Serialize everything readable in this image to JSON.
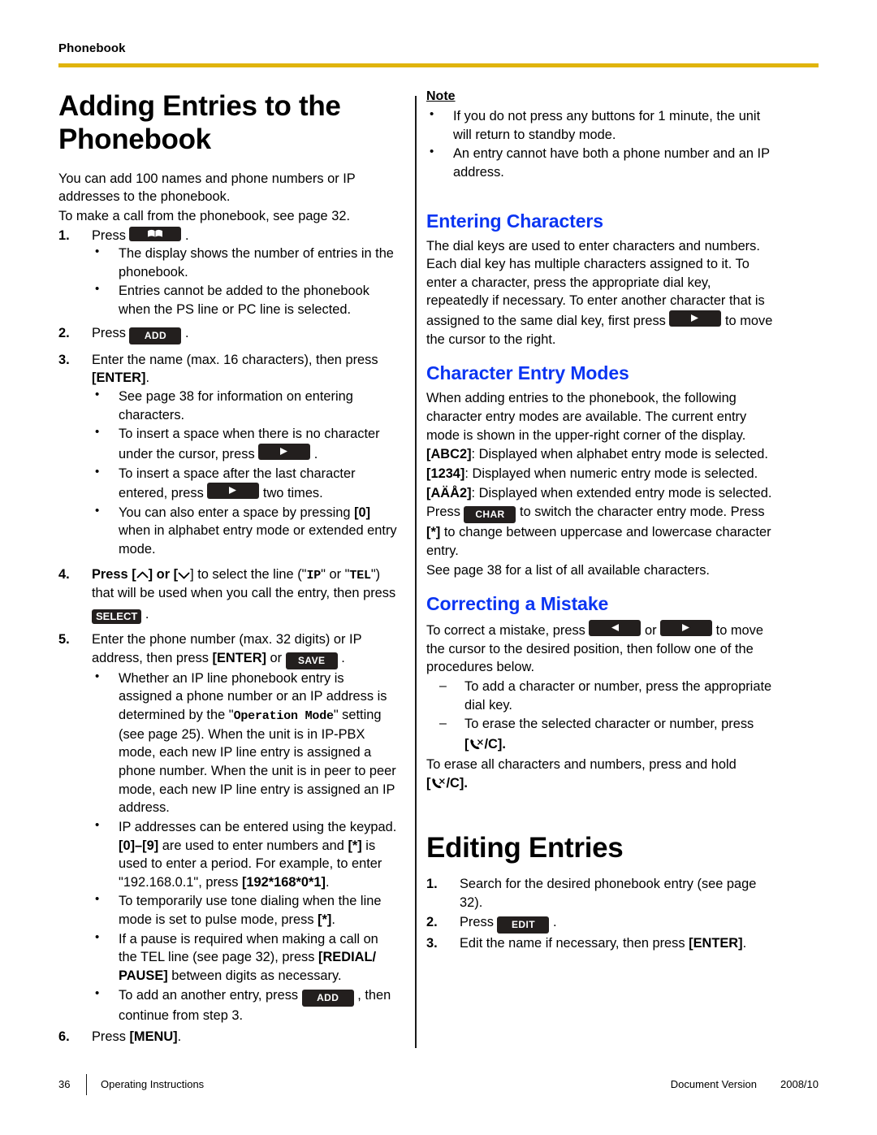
{
  "header": {
    "running_head": "Phonebook",
    "rule_color": "#E0B40C"
  },
  "colors": {
    "heading_blue": "#0B35F2",
    "chip_dark": "#231f1e",
    "rule_gold": "#E0B40C"
  },
  "left_column": {
    "chapter_title": "Adding Entries to the Phonebook",
    "intro_1": "You can add 100 names and phone numbers or IP addresses to the phonebook.",
    "intro_2": "To make a call from the phonebook, see page 32.",
    "steps": [
      {
        "num": "1.",
        "text_before": "Press",
        "chip": "phonebook-book-icon",
        "text_after": ".",
        "bullets": [
          "The display shows the number of entries in the phonebook.",
          "Entries cannot be added to the phonebook when the PS line or PC line is selected."
        ]
      },
      {
        "num": "2.",
        "text_before": "Press",
        "chip": "ADD",
        "text_after": "."
      },
      {
        "num": "3.",
        "text_a": "Enter the name (max. 16 characters), then press ",
        "text_b": "[ENTER]",
        "text_c": ".",
        "bullets": [
          "See page 38 for information on entering characters.",
          "To insert a space when there is no character under the cursor, press",
          "To insert a space after the last character entered, press",
          "You can also enter a space by pressing [0] when in alphabet entry mode or extended entry mode."
        ],
        "bullet2_chip": ">",
        "bullet2_tail": ".",
        "bullet3_chip": ">",
        "bullet3_tail": "two times.",
        "bullet4_a": "You can also enter a space by pressing ",
        "bullet4_key": "[0]",
        "bullet4_b": " when in alphabet entry mode or extended entry mode."
      },
      {
        "num": "4.",
        "text_a": "Press [",
        "arrow_up": "up-arrow-icon",
        "text_b": "] or [",
        "arrow_down": "down-arrow-icon",
        "text_c": "] to select the line (\"",
        "mono_ip": "IP",
        "text_d": "\" or \"",
        "mono_tel": "TEL",
        "text_e": "\") that will be used when you call the entry, then press",
        "chip": "SELECT",
        "text_f": "."
      },
      {
        "num": "5.",
        "text_a": "Enter the phone number (max. 32 digits) or IP address, then press ",
        "text_b": "[ENTER]",
        "text_c": " or",
        "chip": "SAVE",
        "text_d": ".",
        "bullets": [
          {
            "a": "Whether an IP line phonebook entry is assigned a phone number or an IP address is determined by the \"",
            "mono": "Operation Mode",
            "b": "\" setting (see page 25). When the unit is in IP-PBX mode, each new IP line entry is assigned a phone number. When the unit is in peer to peer mode, each new IP line entry is assigned an IP address."
          },
          {
            "a": "IP addresses can be entered using the keypad. ",
            "bold1": "[0]–[9]",
            "b": " are used to enter numbers and ",
            "bold2": "[*]",
            "c": " is used to enter a period. For example, to enter \"192.168.0.1\", press ",
            "bold3": "[192*168*0*1]",
            "d": "."
          },
          {
            "a": "To temporarily use tone dialing when the line mode is set to pulse mode, press ",
            "bold1": "[*]",
            "b": "."
          },
          {
            "a": "If a pause is required when making a call on the TEL line (see page 32), press ",
            "bold1": "[REDIAL/ PAUSE]",
            "b": " between digits as necessary."
          },
          {
            "a": "To add an another entry, press",
            "chip": "ADD",
            "b": ", then continue from step 3."
          }
        ]
      },
      {
        "num": "6.",
        "text_a": "Press ",
        "text_b": "[MENU]",
        "text_c": "."
      }
    ]
  },
  "right_column": {
    "note_label": "Note",
    "note_bullets": [
      "If you do not press any buttons for 1 minute, the unit will return to standby mode.",
      "An entry cannot have both a phone number and an IP address."
    ],
    "entering_characters": {
      "heading": "Entering Characters",
      "para_a": "The dial keys are used to enter characters and numbers. Each dial key has multiple characters assigned to it. To enter a character, press the appropriate dial key, repeatedly if necessary. To enter another character that is assigned to the same dial key, first press",
      "chip": ">",
      "para_b": "to move the cursor to the right."
    },
    "character_entry_modes": {
      "heading": "Character Entry Modes",
      "intro": "When adding entries to the phonebook, the following character entry modes are available. The current entry mode is shown in the upper-right corner of the display.",
      "modes": [
        {
          "key": "[ABC2]",
          "desc": ": Displayed when alphabet entry mode is selected."
        },
        {
          "key": "[1234]",
          "desc": ": Displayed when numeric entry mode is selected."
        },
        {
          "key": "[AÄÅ2]",
          "desc": ": Displayed when extended entry mode is selected."
        }
      ],
      "press_a": "Press",
      "chip": "CHAR",
      "press_b": "to switch the character entry mode. Press ",
      "press_key": "[*]",
      "press_c": " to change between uppercase and lowercase character entry.",
      "see_page": "See page 38 for a list of all available characters."
    },
    "correcting_a_mistake": {
      "heading": "Correcting a Mistake",
      "para_a": "To correct a mistake, press",
      "chip_left": "<",
      "para_or": "or",
      "chip_right": ">",
      "para_b": "to move the cursor to the desired position, then follow one of the procedures below.",
      "dashes": [
        "To add a character or number, press the appropriate dial key.",
        "To erase the selected character or number, press"
      ],
      "dash2_key_prefix": "[",
      "dash2_key_icon": "phone-clear-icon",
      "dash2_key_suffix": "/C].",
      "erase_all_a": "To erase all characters and numbers, press and hold",
      "erase_all_key_prefix": "[",
      "erase_all_key_icon": "phone-clear-icon",
      "erase_all_key_suffix": "/C]."
    },
    "editing_entries": {
      "heading": "Editing Entries",
      "steps": [
        {
          "num": "1.",
          "text": "Search for the desired phonebook entry (see page 32)."
        },
        {
          "num": "2.",
          "text_a": "Press",
          "chip": "EDIT",
          "text_b": "."
        },
        {
          "num": "3.",
          "text_a": "Edit the name if necessary, then press ",
          "text_b": "[ENTER]",
          "text_c": "."
        }
      ]
    }
  },
  "footer": {
    "page_number": "36",
    "doc_title": "Operating Instructions",
    "doc_version_label": "Document Version",
    "doc_version_value": "2008/10"
  }
}
